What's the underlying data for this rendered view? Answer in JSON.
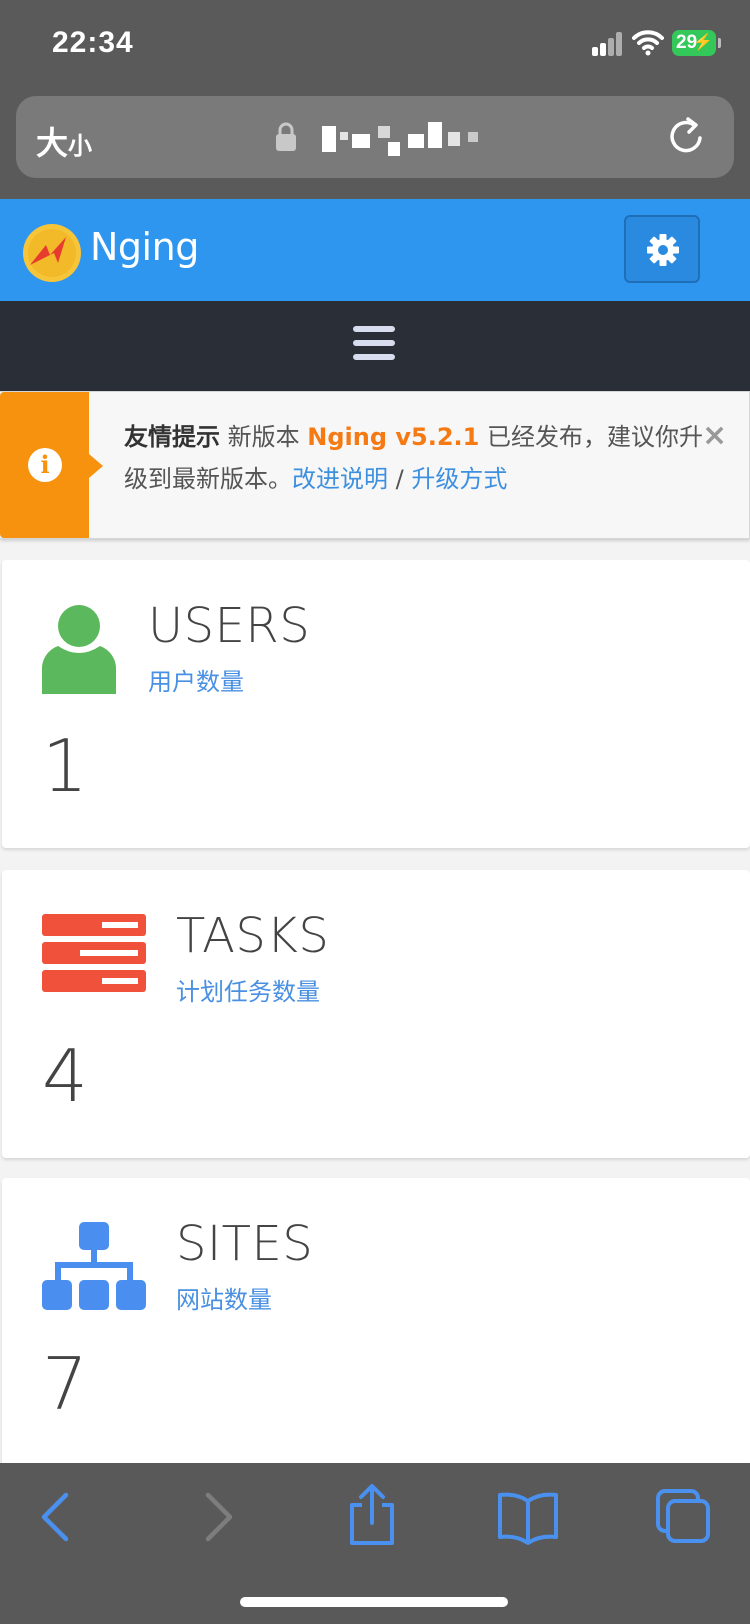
{
  "status_bar": {
    "time": "22:34",
    "battery": "29"
  },
  "address_bar": {
    "text_size_label": "大",
    "text_size_small": "小"
  },
  "app": {
    "brand": "Nging"
  },
  "alert": {
    "title": "友情提示",
    "before_version": " 新版本 ",
    "version": "Nging v5.2.1",
    "after_version": " 已经发布，建议你升级到最新版本。",
    "link_changelog": "改进说明",
    "separator": " / ",
    "link_upgrade": "升级方式",
    "close": "×"
  },
  "stats": {
    "users": {
      "title": "USERS",
      "subtitle": "用户数量",
      "value": "1"
    },
    "tasks": {
      "title": "TASKS",
      "subtitle": "计划任务数量",
      "value": "4"
    },
    "sites": {
      "title": "SITES",
      "subtitle": "网站数量",
      "value": "7"
    }
  },
  "colors": {
    "header": "#2f96f0",
    "nav": "#2a2e36",
    "alert_accent": "#f7920f",
    "users_icon": "#5cb85c",
    "tasks_icon": "#f0513a",
    "sites_icon": "#4a8fef"
  },
  "icons": [
    "lock-icon",
    "reload-icon",
    "gear-icon",
    "hamburger-menu-icon",
    "info-icon",
    "close-icon",
    "user-icon",
    "server-icon",
    "sitemap-icon",
    "back-icon",
    "forward-icon",
    "share-icon",
    "bookmarks-icon",
    "tabs-icon"
  ]
}
